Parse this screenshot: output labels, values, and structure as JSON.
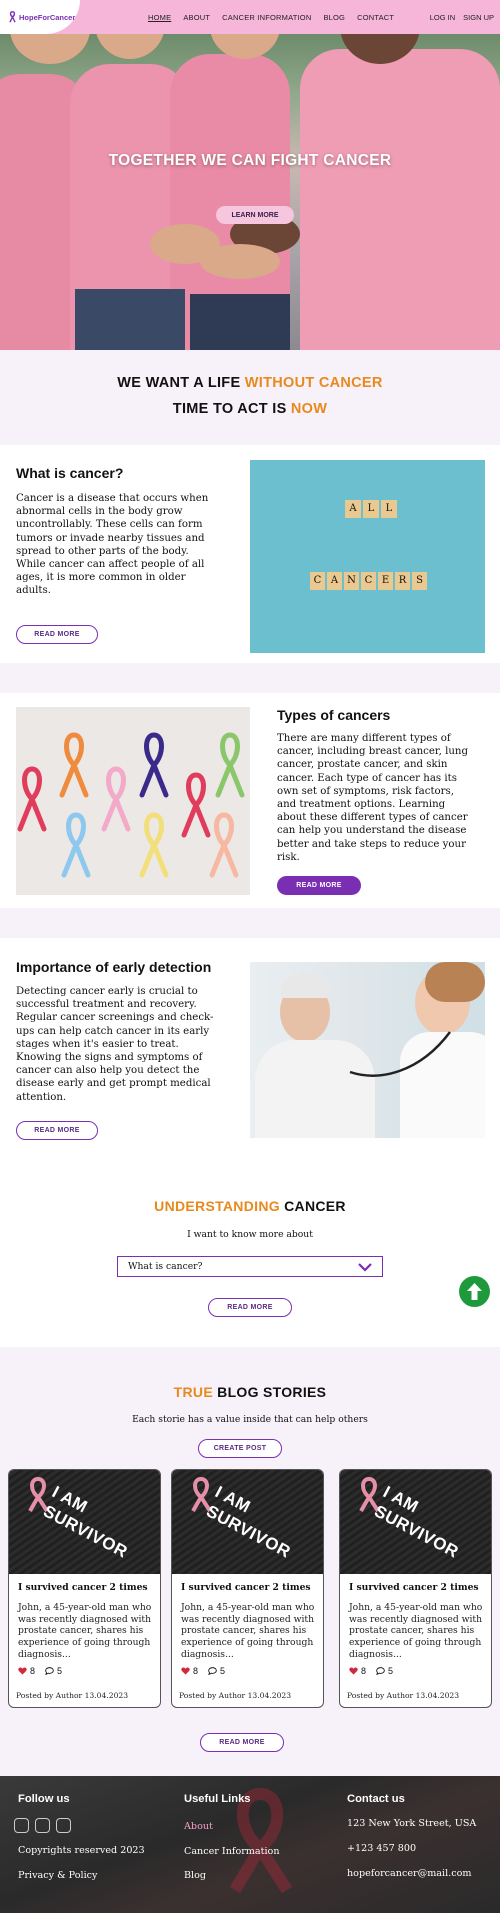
{
  "header": {
    "logo_text": "HopeForCancer",
    "nav": [
      {
        "label": "HOME",
        "active": true
      },
      {
        "label": "ABOUT"
      },
      {
        "label": "CANCER INFORMATION"
      },
      {
        "label": "BLOG"
      },
      {
        "label": "CONTACT"
      }
    ],
    "login": "LOG IN",
    "signup": "SIGN UP"
  },
  "hero": {
    "title": "TOGETHER WE CAN FIGHT CANCER",
    "button": "LEARN MORE"
  },
  "motto": {
    "line1_a": "WE WANT A LIFE ",
    "line1_b": "WITHOUT CANCER",
    "line2_a": "TIME TO ACT IS ",
    "line2_b": "NOW"
  },
  "what": {
    "title": "What is cancer?",
    "text": "Cancer is a disease that occurs when abnormal cells in the body grow uncontrollably. These cells can form tumors or invade nearby tissues and spread to other parts of the body. While cancer can affect people of all ages, it is more common in older adults.",
    "button": "READ MORE",
    "tile_word1": "ALL",
    "tile_word2": "CANCERS"
  },
  "types": {
    "title": "Types of cancers",
    "text": "There are many different types of cancer, including breast cancer, lung cancer, prostate cancer, and skin cancer. Each type of cancer has its own set of symptoms, risk factors, and treatment options. Learning about these different types of cancer can help you understand the disease better and take steps to reduce your risk.",
    "button": "READ MORE"
  },
  "early": {
    "title": "Importance of early detection",
    "text": "Detecting cancer early is crucial to successful treatment and recovery. Regular cancer screenings and check-ups can help catch cancer in its early stages when it's easier to treat. Knowing the signs and symptoms of cancer can also help you detect the disease early and get prompt medical attention.",
    "button": "READ MORE"
  },
  "understanding": {
    "title_a": "UNDERSTANDING",
    "title_b": " CANCER",
    "subtitle": "I want to know more about",
    "select_value": "What is cancer?",
    "button": "READ MORE"
  },
  "blog": {
    "title_a": "TRUE",
    "title_b": " BLOG STORIES",
    "subtitle": "Each storie has a value inside that can help others",
    "create_button": "CREATE POST",
    "image_text_1": "I AM",
    "image_text_2": "SURVIVOR",
    "cards": [
      {
        "title": "I survived cancer 2 times",
        "excerpt": "John, a 45-year-old man who was recently diagnosed with prostate cancer, shares his experience of going through diagnosis...",
        "likes": "8",
        "comments": "5",
        "meta": "Posted by Author 13.04.2023"
      },
      {
        "title": "I survived cancer 2 times",
        "excerpt": "John, a 45-year-old man who was recently diagnosed with prostate cancer, shares his experience of going through diagnosis...",
        "likes": "8",
        "comments": "5",
        "meta": "Posted by Author 13.04.2023"
      },
      {
        "title": "I survived cancer 2 times",
        "excerpt": "John, a 45-year-old man who was recently diagnosed with prostate cancer, shares his experience of going through diagnosis...",
        "likes": "8",
        "comments": "5",
        "meta": "Posted by Author 13.04.2023"
      }
    ],
    "more_button": "READ MORE"
  },
  "footer": {
    "follow_title": "Follow us",
    "copyright": "Copyrights reserved 2023",
    "privacy": "Privacy & Policy",
    "links_title": "Useful Links",
    "links": [
      "About",
      "Cancer Information",
      "Blog"
    ],
    "contact_title": "Contact us",
    "address": "123 New York Street, USA",
    "phone": "+123 457 800",
    "email": "hopeforcancer@mail.com"
  },
  "colors": {
    "header_pink": "#f5b6d9",
    "brand_purple": "#7a2fb3",
    "accent_orange": "#e8891d",
    "band_lavender": "#f7f1f9",
    "scroll_top_green": "#1e9a3c"
  },
  "icons": [
    "ribbon-logo-icon",
    "chevron-down-icon",
    "arrow-up-icon",
    "heart-icon",
    "comment-icon",
    "facebook-icon"
  ]
}
